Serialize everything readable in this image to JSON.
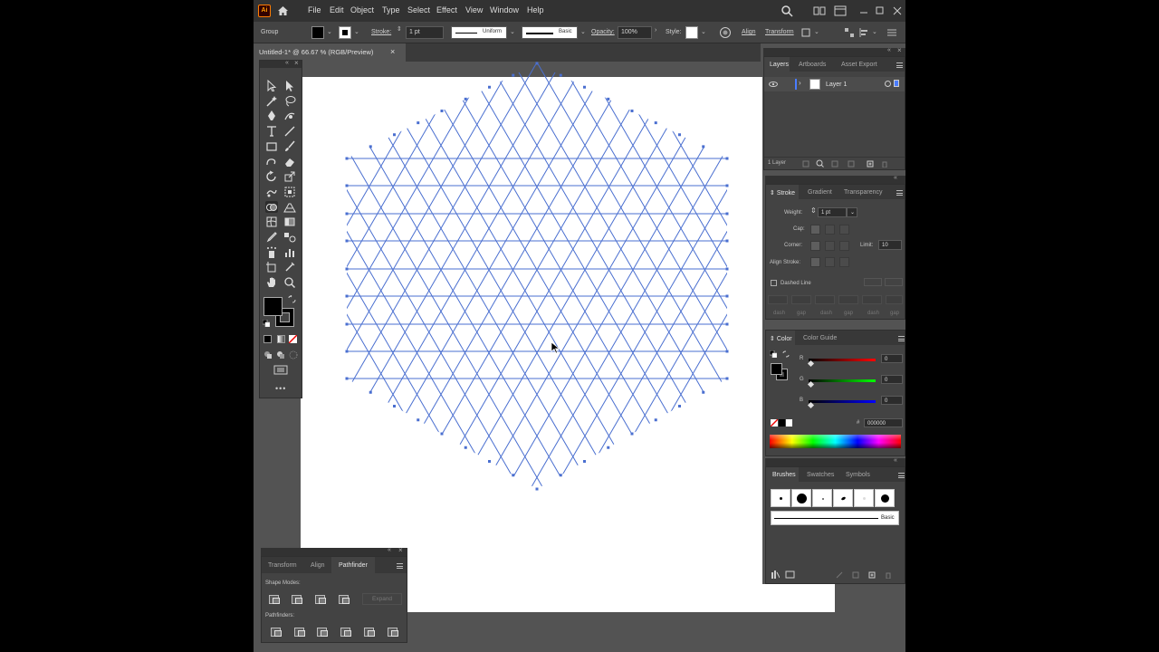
{
  "menubar": {
    "logo": "Ai",
    "items": [
      "File",
      "Edit",
      "Object",
      "Type",
      "Select",
      "Effect",
      "View",
      "Window",
      "Help"
    ]
  },
  "control": {
    "selection": "Group",
    "stroke_label": "Stroke:",
    "stroke_weight": "1 pt",
    "profile": "Uniform",
    "brush": "Basic",
    "opacity_label": "Opacity:",
    "opacity": "100%",
    "style_label": "Style:",
    "align": "Align",
    "transform": "Transform"
  },
  "document": {
    "tab_title": "Untitled-1* @ 66.67 % (RGB/Preview)"
  },
  "layers_panel": {
    "tabs": [
      "Layers",
      "Artboards",
      "Asset Export"
    ],
    "layer_name": "Layer 1",
    "footer": "1 Layer"
  },
  "stroke_panel": {
    "tabs": [
      "Stroke",
      "Gradient",
      "Transparency"
    ],
    "weight_label": "Weight:",
    "weight": "1 pt",
    "cap_label": "Cap:",
    "corner_label": "Corner:",
    "limit_label": "Limit:",
    "limit": "10",
    "align_label": "Align Stroke:",
    "dashed_label": "Dashed Line",
    "dash_labels": [
      "dash",
      "gap",
      "dash",
      "gap",
      "dash",
      "gap"
    ]
  },
  "color_panel": {
    "tabs": [
      "Color",
      "Color Guide"
    ],
    "r_label": "R",
    "r": "0",
    "g_label": "G",
    "g": "0",
    "b_label": "B",
    "b": "0",
    "hash": "#",
    "hex": "000000"
  },
  "brushes_panel": {
    "tabs": [
      "Brushes",
      "Swatches",
      "Symbols"
    ],
    "basic_label": "Basic"
  },
  "pathfinder_panel": {
    "tabs": [
      "Transform",
      "Align",
      "Pathfinder"
    ],
    "shape_modes": "Shape Modes:",
    "expand": "Expand",
    "pathfinders": "Pathfinders:"
  },
  "colors": {
    "ui_dark": "#323232",
    "ui_mid": "#434343",
    "canvas": "#535353",
    "artwork_stroke": "#4a6fd0",
    "accent": "#ff9a00"
  }
}
